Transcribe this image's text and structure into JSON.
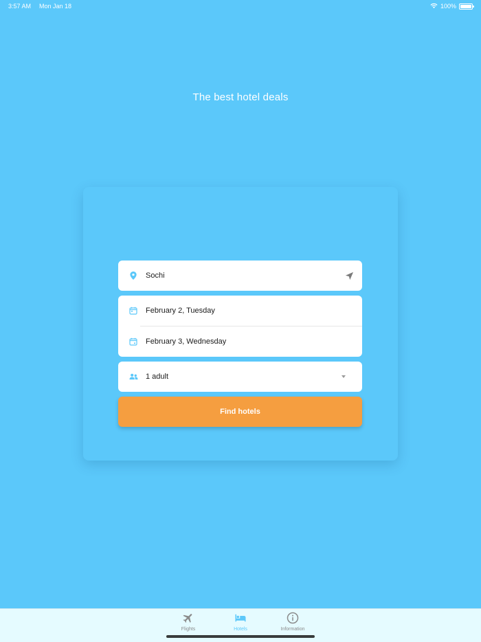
{
  "status_bar": {
    "time": "3:57 AM",
    "date": "Mon Jan 18",
    "battery": "100%"
  },
  "headline": "The best hotel deals",
  "search": {
    "location": "Sochi",
    "check_in": "February 2, Tuesday",
    "check_out": "February 3, Wednesday",
    "guests": "1 adult",
    "button_label": "Find hotels"
  },
  "tabs": [
    {
      "label": "Flights",
      "icon": "airplane-icon",
      "active": false
    },
    {
      "label": "Hotels",
      "icon": "bed-icon",
      "active": true
    },
    {
      "label": "Information",
      "icon": "info-icon",
      "active": false
    }
  ],
  "colors": {
    "background": "#5bc8fa",
    "accent": "#f59e40",
    "active_tab": "#5bc8fa",
    "inactive_tab": "#8b8b8b"
  }
}
